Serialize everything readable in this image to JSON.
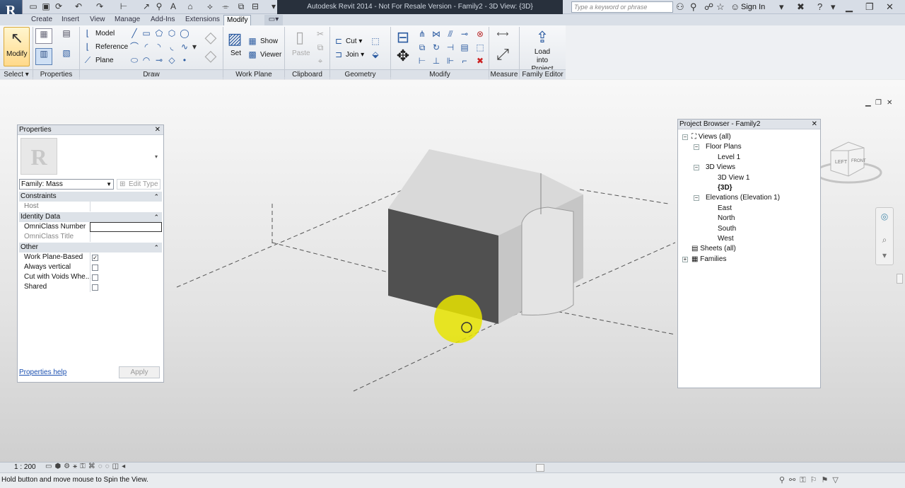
{
  "app": {
    "title": "Autodesk Revit 2014 -  Not For Resale Version -     Family2 - 3D View: {3D}",
    "search_placeholder": "Type a keyword or phrase",
    "sign_in": "Sign In"
  },
  "tabs": [
    "Create",
    "Insert",
    "View",
    "Manage",
    "Add-Ins",
    "Extensions",
    "Modify"
  ],
  "active_tab": "Modify",
  "ribbon": {
    "select": {
      "modify": "Modify",
      "title": "Select"
    },
    "properties": {
      "title": "Properties"
    },
    "draw": {
      "model": "Model",
      "reference": "Reference",
      "plane": "Plane",
      "title": "Draw"
    },
    "work_plane": {
      "set": "Set",
      "show": "Show",
      "viewer": "Viewer",
      "title": "Work Plane"
    },
    "clipboard": {
      "paste": "Paste",
      "title": "Clipboard"
    },
    "geometry": {
      "cut": "Cut",
      "join": "Join",
      "title": "Geometry"
    },
    "modify": {
      "title": "Modify"
    },
    "measure": {
      "title": "Measure"
    },
    "family_editor": {
      "load_line1": "Load into",
      "load_line2": "Project",
      "title": "Family Editor"
    }
  },
  "properties_panel": {
    "title": "Properties",
    "type_selector": "Family: Mass",
    "edit_type": "Edit Type",
    "categories": [
      {
        "name": "Constraints",
        "rows": [
          {
            "label": "Host",
            "value": ""
          }
        ]
      },
      {
        "name": "Identity Data",
        "rows": [
          {
            "label": "OmniClass Number",
            "value": ""
          },
          {
            "label": "OmniClass Title",
            "value": ""
          }
        ]
      },
      {
        "name": "Other",
        "rows": [
          {
            "label": "Work Plane-Based",
            "checked": true
          },
          {
            "label": "Always vertical",
            "checked": false
          },
          {
            "label": "Cut with Voids Whe...",
            "checked": false
          },
          {
            "label": "Shared",
            "checked": false
          }
        ]
      }
    ],
    "help_link": "Properties help",
    "apply": "Apply"
  },
  "project_browser": {
    "title": "Project Browser - Family2",
    "views_all": "Views (all)",
    "floor_plans": "Floor Plans",
    "level1": "Level 1",
    "views_3d": "3D Views",
    "view_3d_1": "3D View 1",
    "view_3d_default": "{3D}",
    "elevations": "Elevations (Elevation 1)",
    "east": "East",
    "north": "North",
    "south": "South",
    "west": "West",
    "sheets": "Sheets (all)",
    "families": "Families"
  },
  "viewcube": {
    "left": "LEFT",
    "front": "FRONT"
  },
  "view_control": {
    "scale": "1 : 200"
  },
  "status": {
    "message": "Hold button and move mouse to Spin the View."
  }
}
